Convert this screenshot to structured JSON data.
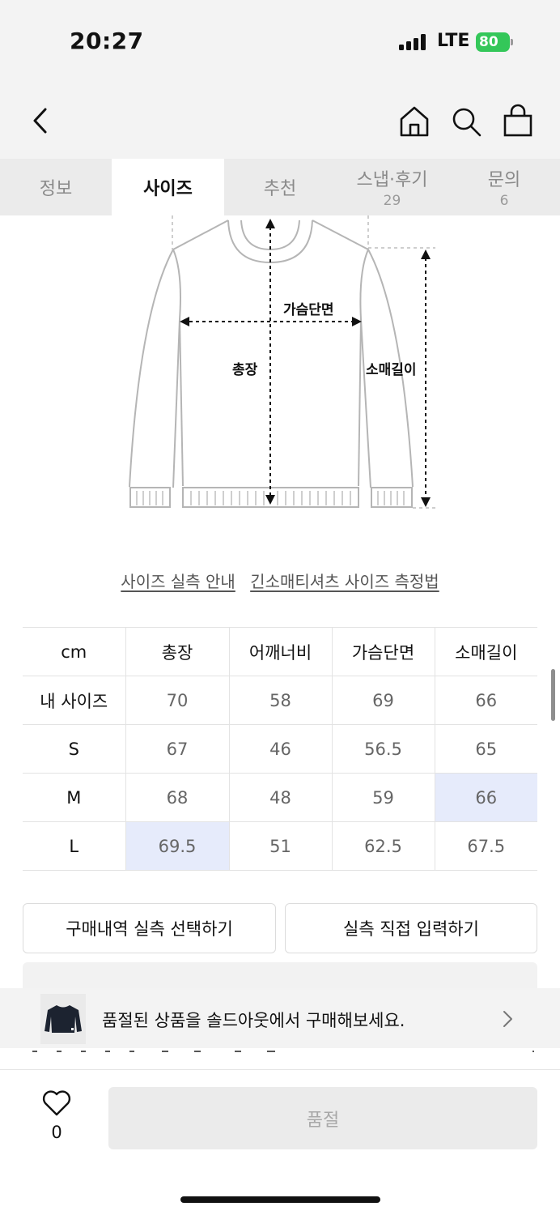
{
  "status_bar": {
    "time": "20:27",
    "network": "LTE",
    "battery": "80"
  },
  "tabs": [
    {
      "label": "정보",
      "count": ""
    },
    {
      "label": "사이즈",
      "count": ""
    },
    {
      "label": "추천",
      "count": ""
    },
    {
      "label": "스냅·후기",
      "count": "29"
    },
    {
      "label": "문의",
      "count": "6"
    }
  ],
  "diagram": {
    "chest": "가슴단면",
    "length": "총장",
    "sleeve": "소매길이"
  },
  "guide_links": {
    "measure_guide": "사이즈 실측 안내",
    "method": "긴소매티셔츠 사이즈 측정법"
  },
  "size_table": {
    "headers": [
      "cm",
      "총장",
      "어깨너비",
      "가슴단면",
      "소매길이"
    ],
    "rows": [
      [
        "내 사이즈",
        "70",
        "58",
        "69",
        "66"
      ],
      [
        "S",
        "67",
        "46",
        "56.5",
        "65"
      ],
      [
        "M",
        "68",
        "48",
        "59",
        "66"
      ],
      [
        "L",
        "69.5",
        "51",
        "62.5",
        "67.5"
      ]
    ]
  },
  "buttons": {
    "purchase_history": "구매내역 실측 선택하기",
    "direct_input": "실측 직접 입력하기"
  },
  "banner": {
    "text": "품절된 상품을 솔드아웃에서 구매해보세요."
  },
  "bottom": {
    "like_count": "0",
    "soldout_label": "품절"
  },
  "colors": {
    "highlight": "#e6ebfb",
    "battery": "#34c759",
    "tab_bg": "#ebebeb"
  }
}
